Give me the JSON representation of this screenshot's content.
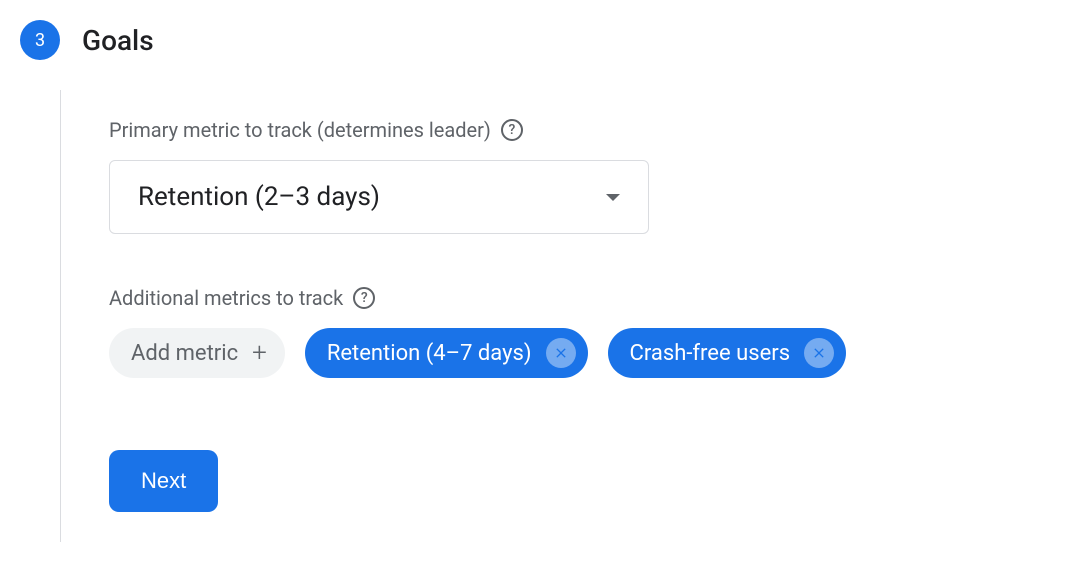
{
  "step": {
    "number": "3",
    "title": "Goals"
  },
  "primary_metric": {
    "label": "Primary metric to track (determines leader)",
    "selected": "Retention (2–3 days)"
  },
  "additional_metrics": {
    "label": "Additional metrics to track",
    "add_label": "Add metric",
    "items": [
      {
        "label": "Retention (4–7 days)"
      },
      {
        "label": "Crash-free users"
      }
    ]
  },
  "next_button": "Next"
}
